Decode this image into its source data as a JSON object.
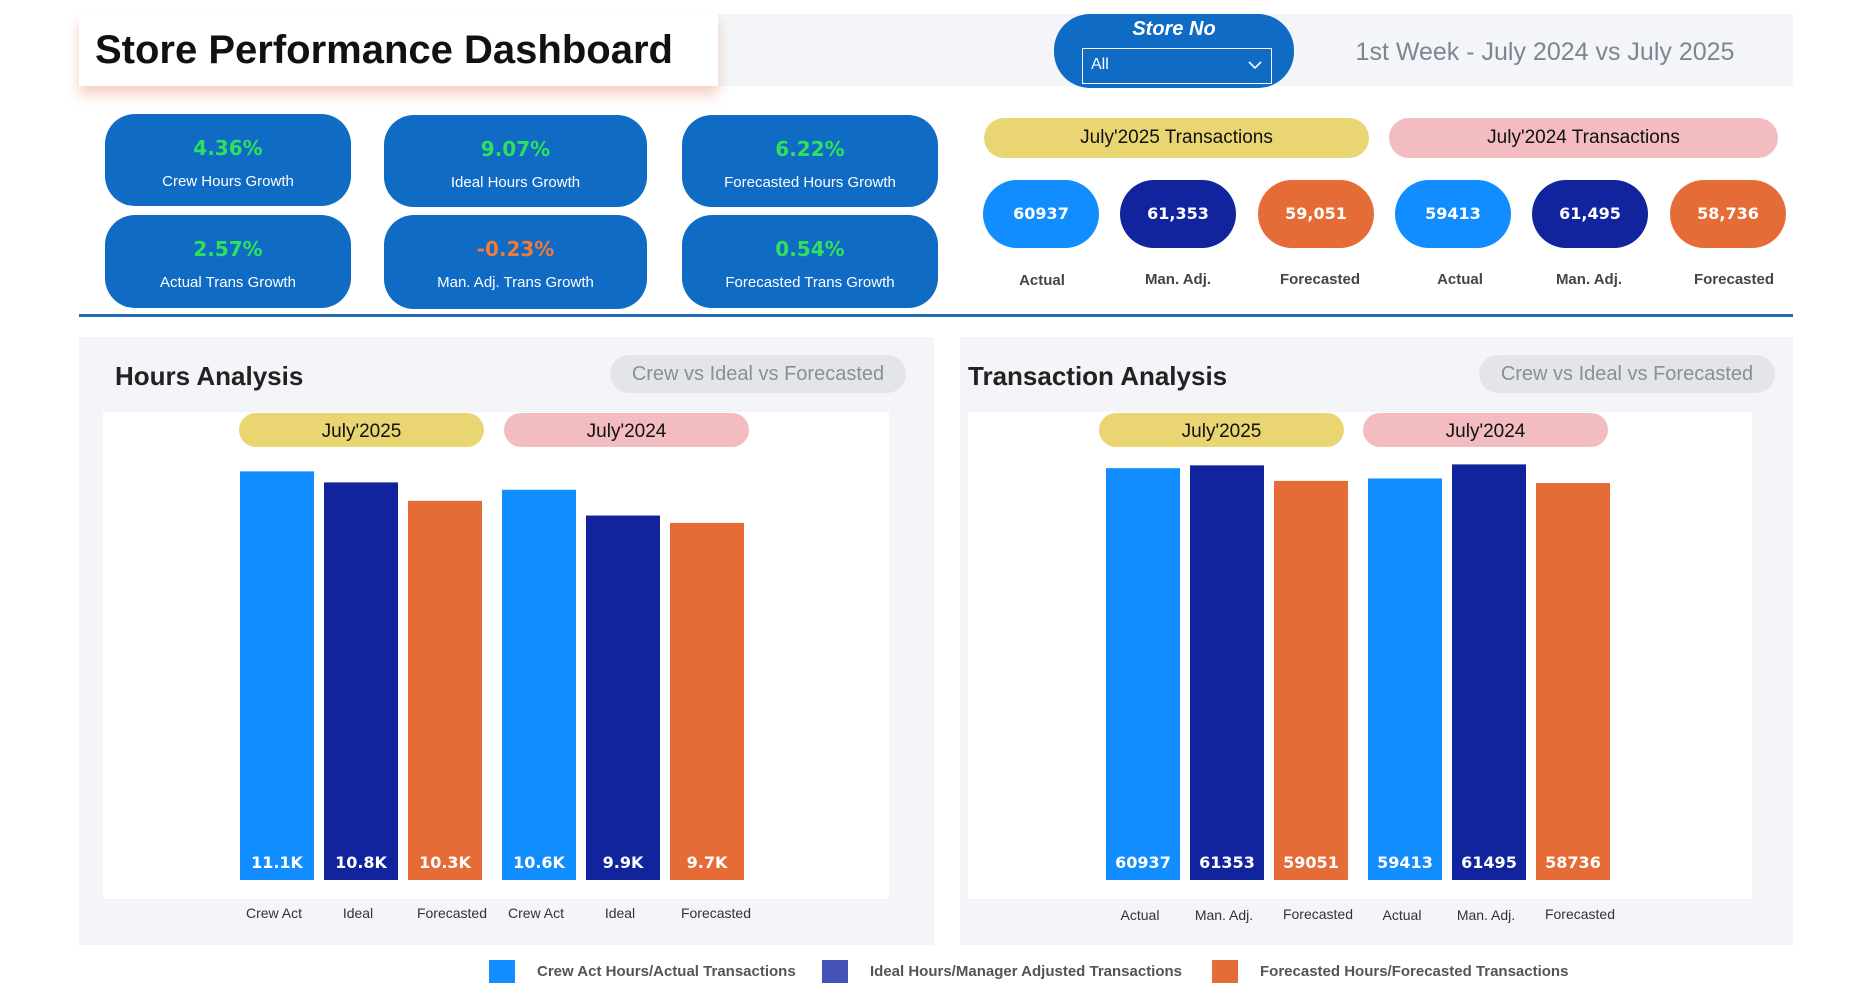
{
  "header": {
    "title": "Store Performance Dashboard",
    "subtitle": "1st Week - July 2024 vs July 2025"
  },
  "store_filter": {
    "label": "Store No",
    "selected": "All"
  },
  "kpis": [
    {
      "value": "4.36%",
      "label": "Crew Hours Growth",
      "color": "#2fe05c"
    },
    {
      "value": "9.07%",
      "label": "Ideal Hours Growth",
      "color": "#2fe05c"
    },
    {
      "value": "6.22%",
      "label": "Forecasted Hours Growth",
      "color": "#2fe05c"
    },
    {
      "value": "2.57%",
      "label": "Actual Trans Growth",
      "color": "#2fe05c"
    },
    {
      "value": "-0.23%",
      "label": "Man. Adj. Trans Growth",
      "color": "#f07a3a"
    },
    {
      "value": "0.54%",
      "label": "Forecasted Trans Growth",
      "color": "#2fe05c"
    }
  ],
  "transactions_2025": {
    "title": "July'2025 Transactions",
    "items": [
      {
        "value": "60937",
        "label": "Actual"
      },
      {
        "value": "61,353",
        "label": "Man. Adj."
      },
      {
        "value": "59,051",
        "label": "Forecasted"
      }
    ]
  },
  "transactions_2024": {
    "title": "July'2024 Transactions",
    "items": [
      {
        "value": "59413",
        "label": "Actual"
      },
      {
        "value": "61,495",
        "label": "Man. Adj."
      },
      {
        "value": "58,736",
        "label": "Forecasted"
      }
    ]
  },
  "colors": {
    "actual": "#118dff",
    "ideal": "#12239e",
    "forecasted": "#e66c37",
    "year_2025": "#e9d673",
    "year_2024": "#f2bcc1",
    "kpi_bg": "#0f6bc4"
  },
  "hours_panel": {
    "title": "Hours Analysis",
    "filter_label": "Crew vs Ideal vs Forecasted"
  },
  "transaction_panel": {
    "title": "Transaction Analysis",
    "filter_label": "Crew vs Ideal vs Forecasted"
  },
  "chart_data": [
    {
      "type": "bar",
      "title": "Hours Analysis",
      "groups": [
        "July'2025",
        "July'2024"
      ],
      "categories": [
        "Crew Act",
        "Ideal",
        "Forecasted",
        "Crew Act",
        "Ideal",
        "Forecasted"
      ],
      "values": [
        11100,
        10800,
        10300,
        10600,
        9900,
        9700
      ],
      "data_labels": [
        "11.1K",
        "10.8K",
        "10.3K",
        "10.6K",
        "9.9K",
        "9.7K"
      ],
      "series_colors": [
        "actual",
        "ideal",
        "forecasted",
        "actual",
        "ideal",
        "forecasted"
      ],
      "ylim": [
        0,
        11300
      ],
      "grid": false
    },
    {
      "type": "bar",
      "title": "Transaction Analysis",
      "groups": [
        "July'2025",
        "July'2024"
      ],
      "categories": [
        "Actual",
        "Man. Adj.",
        "Forecasted",
        "Actual",
        "Man. Adj.",
        "Forecasted"
      ],
      "values": [
        60937,
        61353,
        59051,
        59413,
        61495,
        58736
      ],
      "data_labels": [
        "60937",
        "61353",
        "59051",
        "59413",
        "61495",
        "58736"
      ],
      "series_colors": [
        "actual",
        "ideal",
        "forecasted",
        "actual",
        "ideal",
        "forecasted"
      ],
      "ylim": [
        0,
        61700
      ],
      "grid": false
    }
  ],
  "legend": [
    {
      "label": "Crew Act Hours/Actual Transactions",
      "color": "#118dff"
    },
    {
      "label": "Ideal Hours/Manager Adjusted Transactions",
      "color": "#4553b8"
    },
    {
      "label": "Forecasted Hours/Forecasted Transactions",
      "color": "#e66c37"
    }
  ]
}
